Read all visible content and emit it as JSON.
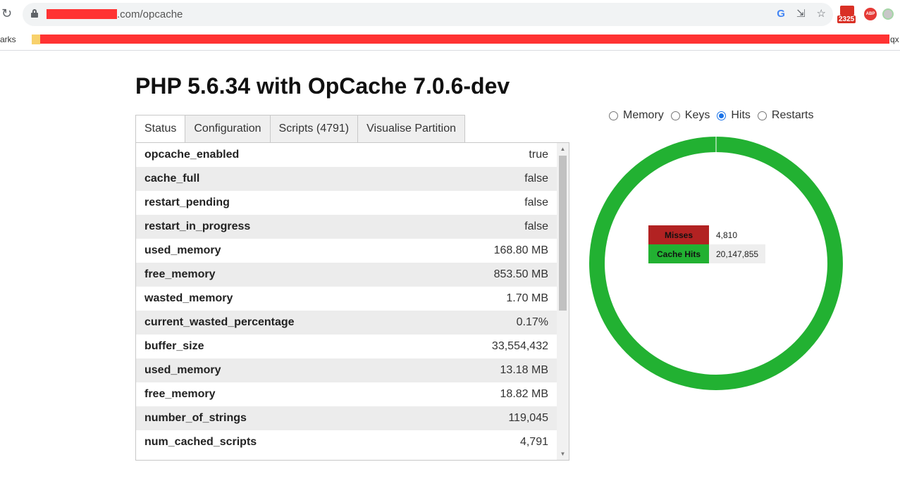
{
  "browser": {
    "url_suffix": ".com/opcache",
    "bookmarks_left": "arks",
    "bookmarks_right": "qx",
    "mail_count": "2325",
    "abp_label": "ABP"
  },
  "page": {
    "title": "PHP 5.6.34 with OpCache 7.0.6-dev"
  },
  "tabs": [
    {
      "label": "Status",
      "active": true
    },
    {
      "label": "Configuration",
      "active": false
    },
    {
      "label": "Scripts (4791)",
      "active": false
    },
    {
      "label": "Visualise Partition",
      "active": false
    }
  ],
  "status_rows": [
    {
      "key": "opcache_enabled",
      "value": "true"
    },
    {
      "key": "cache_full",
      "value": "false"
    },
    {
      "key": "restart_pending",
      "value": "false"
    },
    {
      "key": "restart_in_progress",
      "value": "false"
    },
    {
      "key": "used_memory",
      "value": "168.80 MB"
    },
    {
      "key": "free_memory",
      "value": "853.50 MB"
    },
    {
      "key": "wasted_memory",
      "value": "1.70 MB"
    },
    {
      "key": "current_wasted_percentage",
      "value": "0.17%"
    },
    {
      "key": "buffer_size",
      "value": "33,554,432"
    },
    {
      "key": "used_memory",
      "value": "13.18 MB"
    },
    {
      "key": "free_memory",
      "value": "18.82 MB"
    },
    {
      "key": "number_of_strings",
      "value": "119,045"
    },
    {
      "key": "num_cached_scripts",
      "value": "4,791"
    }
  ],
  "radios": [
    {
      "label": "Memory",
      "checked": false
    },
    {
      "label": "Keys",
      "checked": false
    },
    {
      "label": "Hits",
      "checked": true
    },
    {
      "label": "Restarts",
      "checked": false
    }
  ],
  "chart_data": {
    "type": "pie",
    "style": "donut",
    "slices": [
      {
        "label": "Misses",
        "value": 4810,
        "display": "4,810",
        "color": "#b22222"
      },
      {
        "label": "Cache Hits",
        "value": 20147855,
        "display": "20,147,855",
        "color": "#22b132"
      }
    ]
  },
  "colors": {
    "hits": "#22b132",
    "misses": "#b22222",
    "radio_accent": "#1a73e8"
  }
}
